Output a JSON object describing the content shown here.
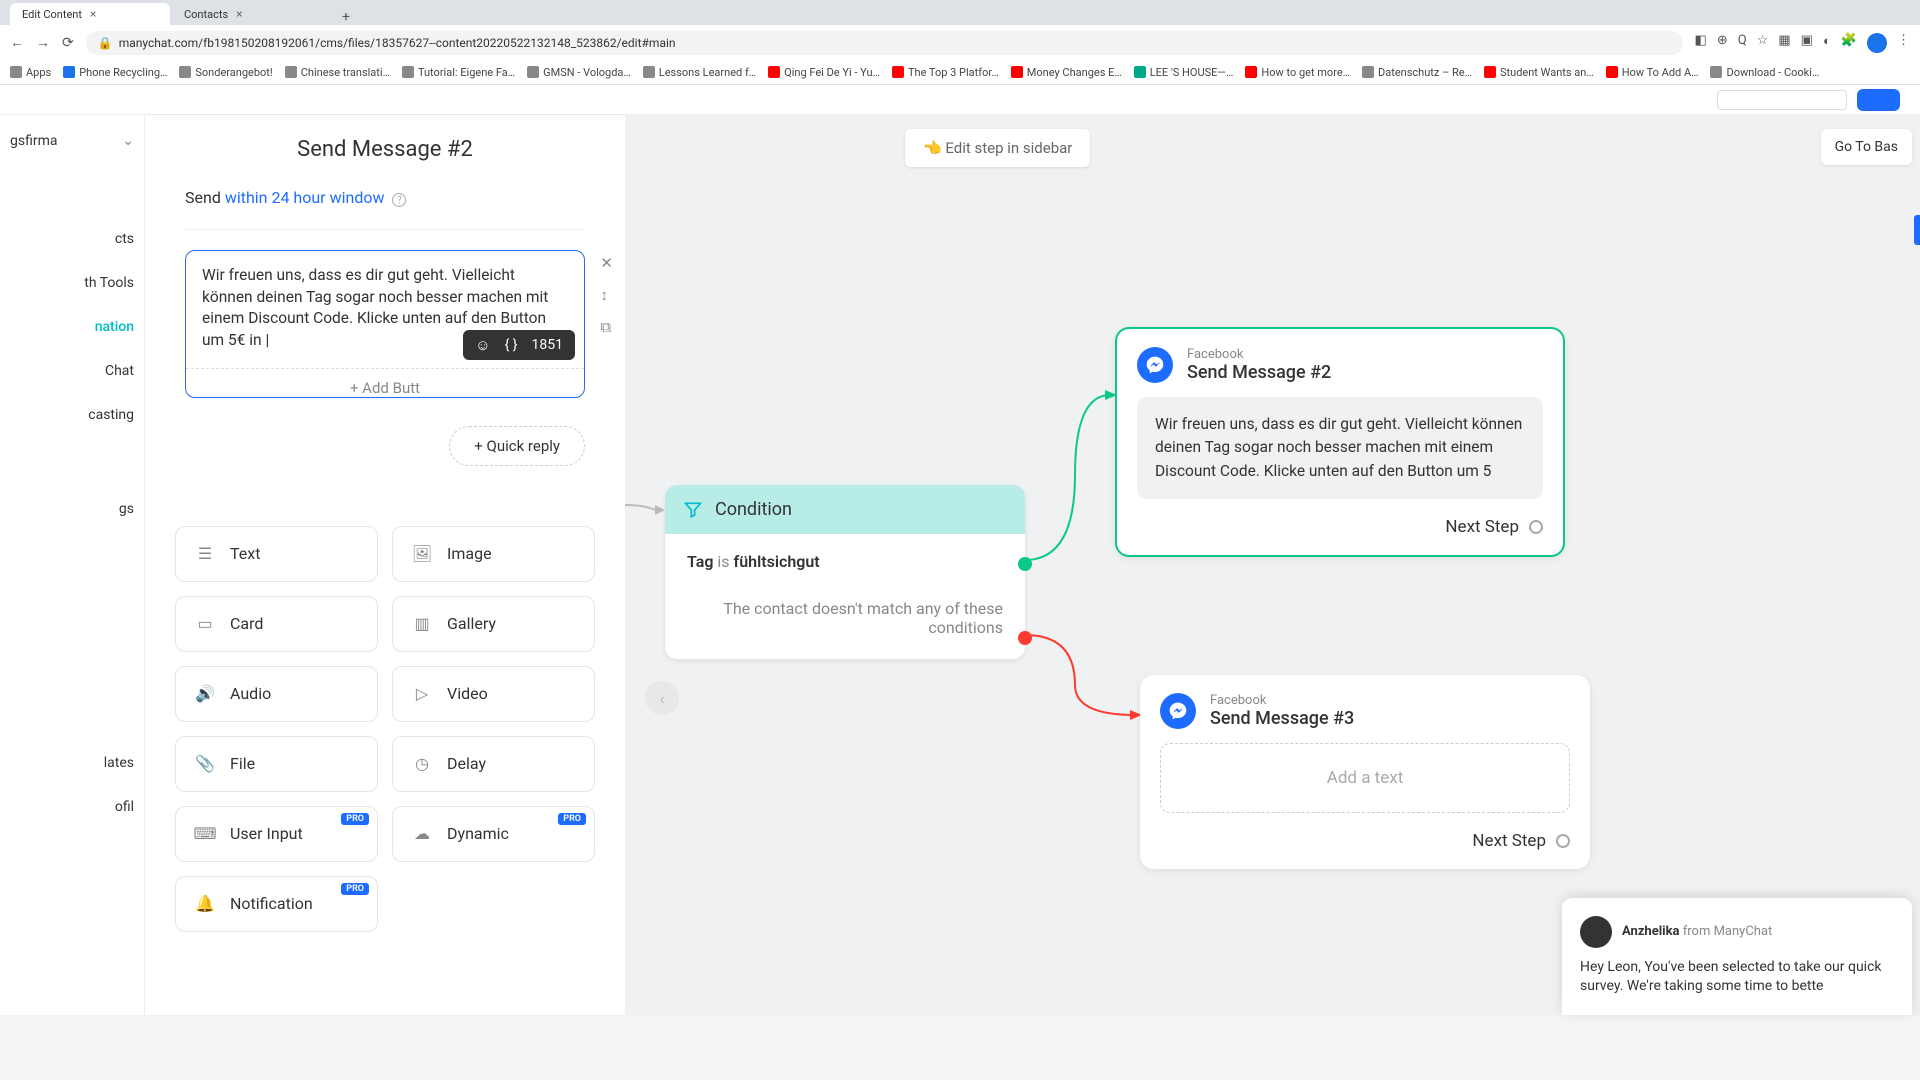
{
  "browser": {
    "tabs": [
      {
        "title": "Edit Content",
        "active": true
      },
      {
        "title": "Contacts",
        "active": false
      }
    ],
    "url": "manychat.com/fb198150208192061/cms/files/18357627--content20220522132148_523862/edit#main",
    "bookmarks": [
      "Apps",
      "Phone Recycling…",
      "Sonderangebot!",
      "Chinese translati…",
      "Tutorial: Eigene Fa…",
      "GMSN - Vologda…",
      "Lessons Learned f…",
      "Qing Fei De Yi - Yu…",
      "The Top 3 Platfor…",
      "Money Changes E…",
      "LEE 'S HOUSE—…",
      "How to get more…",
      "Datenschutz – Re…",
      "Student Wants an…",
      "How To Add A…",
      "Download - Cooki…"
    ]
  },
  "sidebar": {
    "workspace": "gsfirma",
    "items": [
      "cts",
      "th Tools",
      "nation",
      "Chat",
      "casting",
      "gs",
      "lates",
      "ofil"
    ],
    "active_index": 2
  },
  "editor": {
    "title": "Send Message #2",
    "send_label": "Send",
    "send_link": "within 24 hour window",
    "text_content": "Wir freuen uns, dass es dir gut geht. Vielleicht können deinen Tag sogar noch besser machen mit einem Discount Code. Klicke unten auf den Button um 5€ in ",
    "add_button_label": "+ Add Butt",
    "char_count": "1851",
    "quick_reply_label": "+ Quick reply",
    "blocks": [
      {
        "label": "Text",
        "icon": "lines",
        "pro": false
      },
      {
        "label": "Image",
        "icon": "image",
        "pro": false
      },
      {
        "label": "Card",
        "icon": "card",
        "pro": false
      },
      {
        "label": "Gallery",
        "icon": "gallery",
        "pro": false
      },
      {
        "label": "Audio",
        "icon": "audio",
        "pro": false
      },
      {
        "label": "Video",
        "icon": "video",
        "pro": false
      },
      {
        "label": "File",
        "icon": "file",
        "pro": false
      },
      {
        "label": "Delay",
        "icon": "delay",
        "pro": false
      },
      {
        "label": "User Input",
        "icon": "input",
        "pro": true
      },
      {
        "label": "Dynamic",
        "icon": "cloud",
        "pro": true
      },
      {
        "label": "Notification",
        "icon": "bell",
        "pro": true
      }
    ],
    "pro_label": "PRO"
  },
  "canvas": {
    "edit_sidebar_btn": "👈 Edit step in sidebar",
    "go_basic_btn": "Go To Bas",
    "condition": {
      "title": "Condition",
      "body_prefix": "Tag",
      "body_is": "is",
      "body_value": "fühltsichgut",
      "else_text": "The contact doesn't match any of these conditions"
    },
    "msg2": {
      "platform": "Facebook",
      "title": "Send Message #2",
      "body": "Wir freuen uns, dass es dir gut geht. Vielleicht können deinen Tag sogar noch besser machen mit einem Discount Code. Klicke unten auf den Button um 5",
      "next_step": "Next Step"
    },
    "msg3": {
      "platform": "Facebook",
      "title": "Send Message #3",
      "placeholder": "Add a text",
      "next_step": "Next Step"
    }
  },
  "chat": {
    "name": "Anzhelika",
    "from": "from ManyChat",
    "message": "Hey Leon, You've been selected to take our quick survey. We're taking some time to bette"
  }
}
